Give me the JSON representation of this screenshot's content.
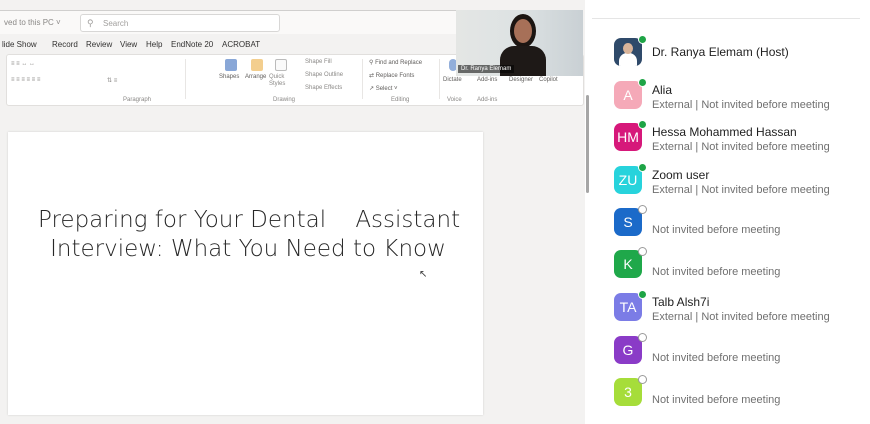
{
  "powerpoint": {
    "saved_status": "ved to this PC ˅",
    "search_placeholder": "Search",
    "tabs": [
      "lide Show",
      "Record",
      "Review",
      "View",
      "Help",
      "EndNote 20",
      "ACROBAT"
    ],
    "ribbon": {
      "shapes": "Shapes",
      "arrange": "Arrange",
      "quick_styles": "Quick Styles",
      "shape_fill": "Shape Fill",
      "shape_outline": "Shape Outline",
      "shape_effects": "Shape Effects",
      "find_replace": "Find and Replace",
      "replace_fonts": "Replace Fonts",
      "select": "Select",
      "dictate": "Dictate",
      "addins": "Add-ins",
      "designer": "Designer",
      "copilot": "Copilot",
      "groups": {
        "paragraph": "Paragraph",
        "drawing": "Drawing",
        "editing": "Editing",
        "voice": "Voice",
        "addins": "Add-ins"
      }
    },
    "slide_title": "Preparing for Your Dental    Assistant\nInterview: What You Need to Know",
    "speaker_name": "Dr. Ranya Elemam"
  },
  "participants": [
    {
      "initials": "",
      "name": "Dr. Ranya Elemam (Host)",
      "subtitle": "",
      "color": "#2f4a6a",
      "status": "online",
      "photo": true
    },
    {
      "initials": "A",
      "name": "Alia",
      "subtitle": "External | Not invited before meeting",
      "color": "#f5a9b8",
      "status": "online"
    },
    {
      "initials": "HM",
      "name": "Hessa Mohammed Hassan",
      "subtitle": "External | Not invited before meeting",
      "color": "#d6187a",
      "status": "online"
    },
    {
      "initials": "ZU",
      "name": "Zoom user",
      "subtitle": "External | Not invited before meeting",
      "color": "#27d3dc",
      "status": "online"
    },
    {
      "initials": "S",
      "name": "",
      "subtitle": "Not invited before meeting",
      "color": "#1b6ac9",
      "status": "offline"
    },
    {
      "initials": "K",
      "name": "",
      "subtitle": "Not invited before meeting",
      "color": "#1fa84a",
      "status": "offline"
    },
    {
      "initials": "TA",
      "name": "Talb Alsh7i",
      "subtitle": "External | Not invited before meeting",
      "color": "#7b7ce6",
      "status": "online"
    },
    {
      "initials": "G",
      "name": "",
      "subtitle": "Not invited before meeting",
      "color": "#8a3bc7",
      "status": "offline"
    },
    {
      "initials": "3",
      "name": "",
      "subtitle": "Not invited before meeting",
      "color": "#a6dd3a",
      "status": "offline"
    }
  ]
}
